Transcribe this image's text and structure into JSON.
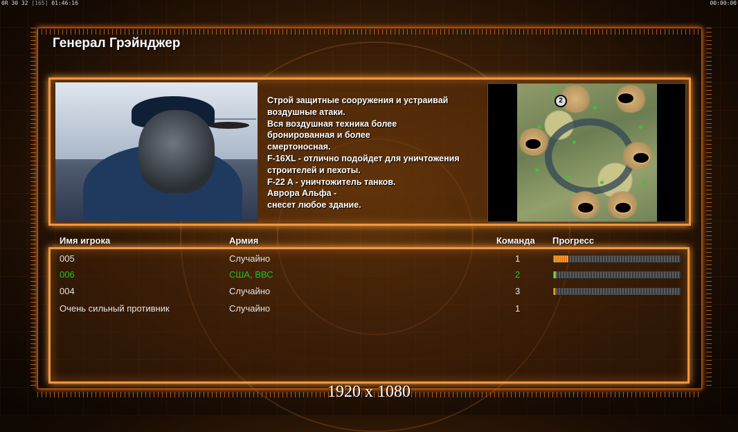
{
  "hud": {
    "left_a": "0R 30 32",
    "left_b": "[165]",
    "left_c": "01:46:16",
    "right": "00:00:00"
  },
  "title": "Генерал Грэйнджер",
  "description": "Строй защитные сооружения и устраивай\n воздушные атаки.\nВся воздушная техника более\n бронированная и более\nсмертоносная.\nF-16XL - отлично подойдет для уничтожения\n строителей и пехоты.\nF-22 A - уничтожитель танков.\nАврора Альфа -\nснесет любое здание.",
  "minimap": {
    "player_marker": "2",
    "icon": "map-preview"
  },
  "table": {
    "headers": {
      "name": "Имя игрока",
      "army": "Армия",
      "team": "Команда",
      "progress": "Прогресс"
    },
    "rows": [
      {
        "name": "005",
        "army": "Случайно",
        "team": "1",
        "progress": 0.12,
        "color": "#e6e6e6",
        "bar_color": "#e06a10"
      },
      {
        "name": "006",
        "army": "США, ВВС",
        "team": "2",
        "progress": 0.02,
        "color": "#22c522",
        "bar_color": "#22c522"
      },
      {
        "name": "004",
        "army": "Случайно",
        "team": "3",
        "progress": 0.01,
        "color": "#e6e6e6",
        "bar_color": "#e06a10"
      },
      {
        "name": "Очень сильный противник",
        "army": "Случайно",
        "team": "1",
        "progress": null,
        "color": "#e6e6e6",
        "bar_color": ""
      }
    ]
  },
  "resolution": "1920 x 1080",
  "colors": {
    "accent": "#f09840",
    "frame": "#c85a10"
  }
}
